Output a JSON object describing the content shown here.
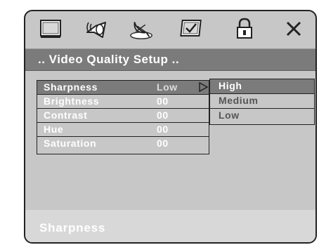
{
  "toolbar": {
    "icons": [
      {
        "name": "system-setup-icon",
        "selected": false
      },
      {
        "name": "audio-speaker-icon",
        "selected": false
      },
      {
        "name": "video-satellite-dish-icon",
        "selected": true
      },
      {
        "name": "preferences-checkbox-icon",
        "selected": false
      },
      {
        "name": "password-lock-icon",
        "selected": false
      },
      {
        "name": "exit-close-icon",
        "selected": false
      }
    ]
  },
  "title": {
    "text": "..  Video Quality Setup  .."
  },
  "settings": {
    "items": [
      {
        "label": "Sharpness",
        "value": "Low",
        "active": true
      },
      {
        "label": "Brightness",
        "value": "00",
        "active": false
      },
      {
        "label": "Contrast",
        "value": "00",
        "active": false
      },
      {
        "label": "Hue",
        "value": "00",
        "active": false
      },
      {
        "label": "Saturation",
        "value": "00",
        "active": false
      }
    ]
  },
  "options": {
    "items": [
      {
        "label": "High",
        "active": true
      },
      {
        "label": "Medium",
        "active": false
      },
      {
        "label": "Low",
        "active": false
      }
    ]
  },
  "status": {
    "text": "Sharpness"
  },
  "colors": {
    "panel_background": "#c7c7c7",
    "highlight": "#7b7b7b",
    "border": "#222222",
    "status_bar": "#d8d8d8",
    "text": "#ffffff"
  }
}
